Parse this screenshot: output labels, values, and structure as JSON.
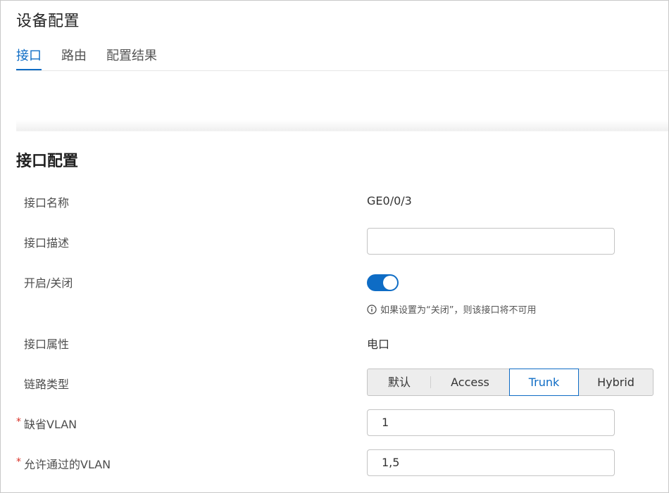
{
  "header": {
    "title": "设备配置"
  },
  "tabs": [
    {
      "label": "接口",
      "active": true
    },
    {
      "label": "路由",
      "active": false
    },
    {
      "label": "配置结果",
      "active": false
    }
  ],
  "section": {
    "title": "接口配置"
  },
  "form": {
    "interface_name": {
      "label": "接口名称",
      "value": "GE0/0/3"
    },
    "interface_desc": {
      "label": "接口描述",
      "value": ""
    },
    "enable": {
      "label": "开启/关闭",
      "on": true,
      "hint": "如果设置为“关闭”，则该接口将不可用"
    },
    "interface_attr": {
      "label": "接口属性",
      "value": "电口"
    },
    "link_type": {
      "label": "链路类型",
      "options": [
        "默认",
        "Access",
        "Trunk",
        "Hybrid"
      ],
      "selected": "Trunk"
    },
    "default_vlan": {
      "required_mark": "*",
      "label": "缺省VLAN",
      "value": "1"
    },
    "allowed_vlan": {
      "required_mark": "*",
      "label": "允许通过的VLAN",
      "value": "1,5"
    }
  },
  "colors": {
    "accent": "#0e6cc5",
    "required": "#d93026"
  }
}
